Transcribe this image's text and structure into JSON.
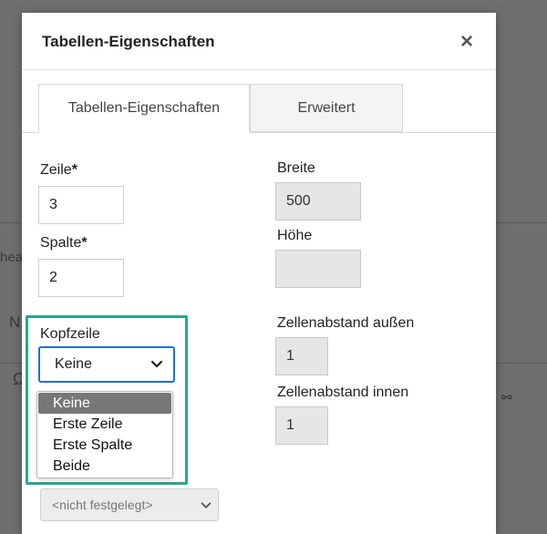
{
  "background": {
    "frag1": "hea",
    "frag2": "N",
    "frag3": "Ω"
  },
  "dialog": {
    "title": "Tabellen-Eigenschaften",
    "close_symbol": "×",
    "tabs": [
      {
        "label": "Tabellen-Eigenschaften",
        "active": true
      },
      {
        "label": "Erweitert",
        "active": false
      }
    ],
    "fields": {
      "rows": {
        "label": "Zeile",
        "required_mark": "*",
        "value": "3"
      },
      "cols": {
        "label": "Spalte",
        "required_mark": "*",
        "value": "2"
      },
      "width": {
        "label": "Breite",
        "value": "500"
      },
      "height": {
        "label": "Höhe",
        "value": ""
      },
      "outer_spacing": {
        "label": "Zellenabstand außen",
        "value": "1"
      },
      "inner_spacing": {
        "label": "Zellenabstand innen",
        "value": "1"
      }
    },
    "header_select": {
      "label": "Kopfzeile",
      "selected": "Keine",
      "options": [
        "Keine",
        "Erste Zeile",
        "Erste Spalte",
        "Beide"
      ]
    },
    "alignment_select": {
      "selected": "<nicht festgelegt>"
    }
  },
  "colors": {
    "highlight": "#2ba58d",
    "focus": "#1f6fd1",
    "selected_option": "#777777"
  }
}
